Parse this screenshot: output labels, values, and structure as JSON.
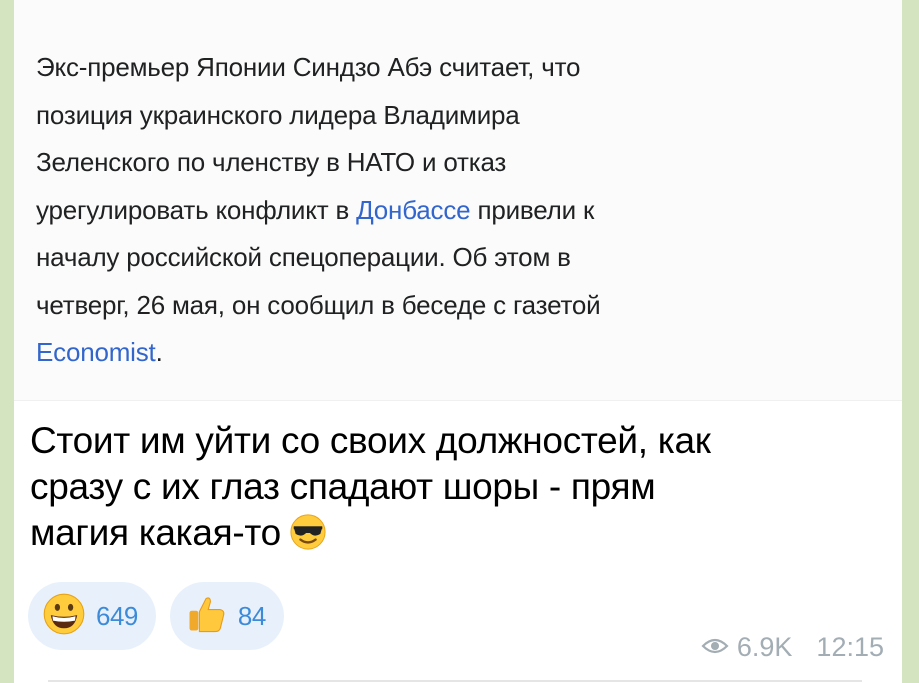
{
  "post": {
    "quote_lines": [
      "Экс-премьер Японии Синдзо Абэ считает, что",
      "позиция украинского лидера Владимира",
      "Зеленского по членству в НАТО и отказ"
    ],
    "quote_line4_before": "урегулировать конфликт в ",
    "quote_link_donbass": "Донбассе",
    "quote_line4_after": " привели к",
    "quote_line5": "началу российской спецоперации. Об этом в",
    "quote_line6": "четверг, 26 мая, он сообщил в беседе с газетой",
    "quote_link_economist": "Economist",
    "quote_end": ".",
    "message_lines": [
      "Стоит им уйти со своих должностей, как",
      "сразу с их глаз спадают шоры - прям",
      "магия какая-то"
    ],
    "message_emoji_icon": "smiling-face-with-sunglasses-icon"
  },
  "reactions": [
    {
      "icon": "grinning-face-icon",
      "count": "649"
    },
    {
      "icon": "thumbs-up-icon",
      "count": "84"
    }
  ],
  "meta": {
    "views": "6.9K",
    "time": "12:15"
  },
  "colors": {
    "link": "#3366cc",
    "reaction_bg": "#e8f1fb",
    "reaction_count": "#3d8bd8",
    "meta": "#a3adb4"
  }
}
